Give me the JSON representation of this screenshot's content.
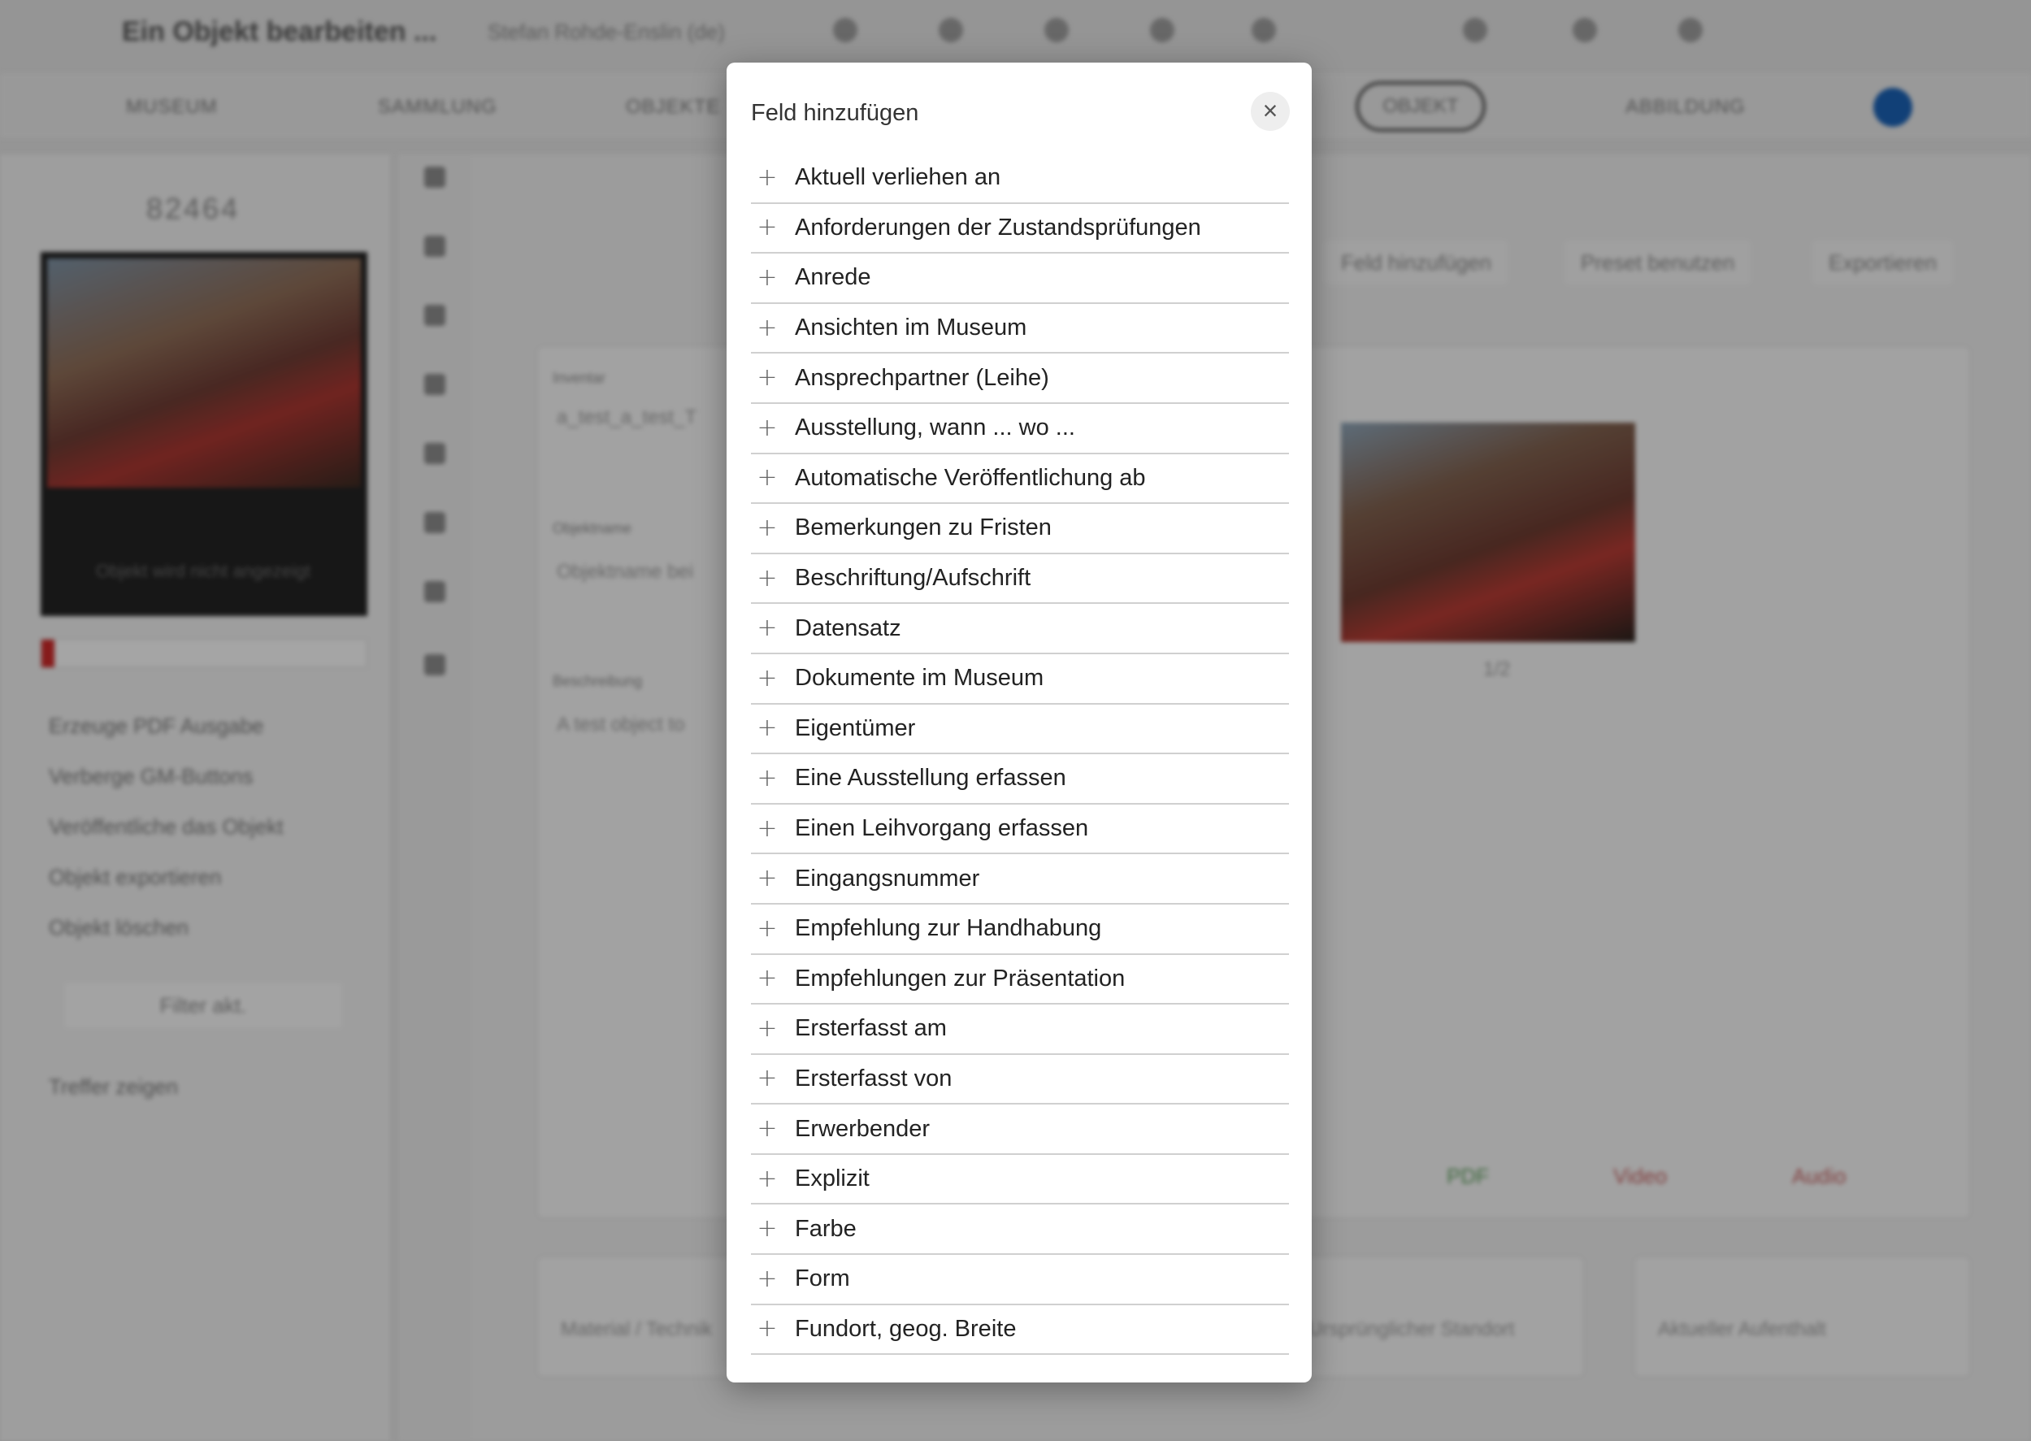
{
  "background": {
    "app_title": "Ein Objekt bearbeiten ...",
    "user": "Stefan Rohde-Enslin (de)",
    "nav": [
      "MUSEUM",
      "SAMMLUNG",
      "OBJEKTE",
      "OBJEKT",
      "ABBILDUNG"
    ],
    "pager": "82464",
    "thumb_caption": "Objekt wird nicht angezeigt",
    "side_actions": [
      "Erzeuge PDF Ausgabe",
      "Verberge GM-Buttons",
      "Veröffentliche das Objekt",
      "Objekt exportieren",
      "Objekt löschen"
    ],
    "filter_label": "Filter akt.",
    "hits_label": "Treffer zeigen",
    "toolbar": [
      "Feld hinzufügen",
      "Preset benutzen",
      "Exportieren"
    ],
    "card_labels": [
      "Inventar",
      "Objektname",
      "Beschreibung"
    ],
    "card_texts": [
      "a_test_a_test_T",
      "Objektname bei",
      "A test object to"
    ],
    "bottom_fields": [
      "Material / Technik",
      "Ursprünglicher Standort",
      "Aktueller Aufenthalt"
    ],
    "media": [
      "PDF",
      "Video",
      "Audio"
    ],
    "image_counter": "1/2"
  },
  "modal": {
    "title": "Feld hinzufügen",
    "close_icon": "close-icon",
    "plus_icon": "+",
    "items": [
      "Aktuell verliehen an",
      "Anforderungen der Zustandsprüfungen",
      "Anrede",
      "Ansichten im Museum",
      "Ansprechpartner (Leihe)",
      "Ausstellung, wann ... wo ...",
      "Automatische Veröffentlichung ab",
      "Bemerkungen zu Fristen",
      "Beschriftung/Aufschrift",
      "Datensatz",
      "Dokumente im Museum",
      "Eigentümer",
      "Eine Ausstellung erfassen",
      "Einen Leihvorgang erfassen",
      "Eingangsnummer",
      "Empfehlung zur Handhabung",
      "Empfehlungen zur Präsentation",
      "Ersterfasst am",
      "Ersterfasst von",
      "Erwerbender",
      "Explizit",
      "Farbe",
      "Form",
      "Fundort, geog. Breite"
    ]
  }
}
